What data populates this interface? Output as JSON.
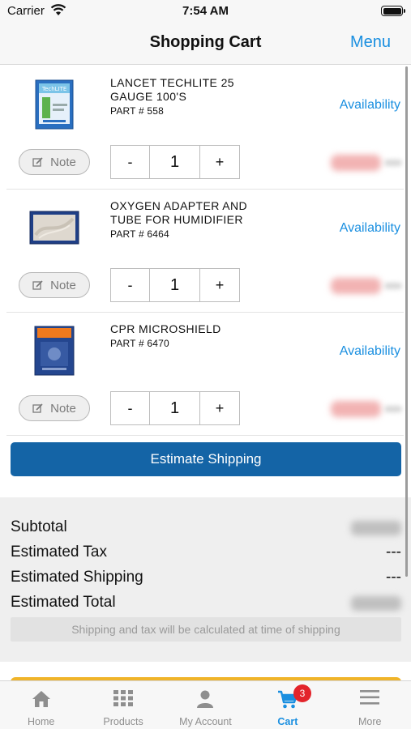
{
  "status_bar": {
    "carrier": "Carrier",
    "time": "7:54 AM"
  },
  "nav": {
    "title": "Shopping Cart",
    "menu_label": "Menu"
  },
  "items": [
    {
      "name": "LANCET TECHLITE 25 GAUGE 100'S",
      "part": "Part # 558",
      "availability": "Availability",
      "note_label": "Note",
      "qty": "1",
      "minus": "-",
      "plus": "+"
    },
    {
      "name": "OXYGEN ADAPTER AND TUBE FOR HUMIDIFIER",
      "part": "Part # 6464",
      "availability": "Availability",
      "note_label": "Note",
      "qty": "1",
      "minus": "-",
      "plus": "+"
    },
    {
      "name": "CPR MICROSHIELD",
      "part": "Part # 6470",
      "availability": "Availability",
      "note_label": "Note",
      "qty": "1",
      "minus": "-",
      "plus": "+"
    }
  ],
  "estimate_shipping_label": "Estimate Shipping",
  "summary": {
    "subtotal_label": "Subtotal",
    "tax_label": "Estimated Tax",
    "tax_value": "---",
    "shipping_label": "Estimated Shipping",
    "shipping_value": "---",
    "total_label": "Estimated Total",
    "note": "Shipping and tax will be calculated at time of shipping"
  },
  "tabs": [
    {
      "label": "Home",
      "icon": "home-icon"
    },
    {
      "label": "Products",
      "icon": "grid-icon"
    },
    {
      "label": "My Account",
      "icon": "person-icon"
    },
    {
      "label": "Cart",
      "icon": "cart-icon",
      "active": true
    },
    {
      "label": "More",
      "icon": "hamburger-icon"
    }
  ],
  "cart_badge": "3",
  "colors": {
    "accent": "#1a8fe0",
    "primary_button": "#1464a6",
    "badge": "#e3242b",
    "checkout": "#f0b429"
  }
}
